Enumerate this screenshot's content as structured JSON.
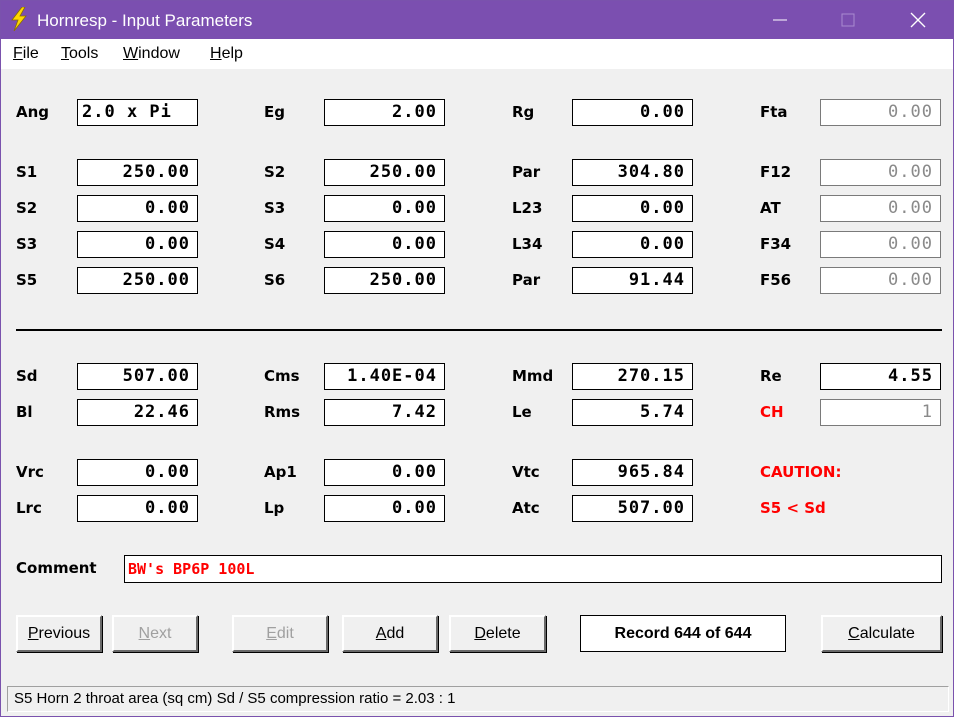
{
  "window": {
    "title": "Hornresp - Input Parameters",
    "icon": "lightning-bolt-icon"
  },
  "menu": {
    "file": {
      "key": "F",
      "rest": "ile"
    },
    "tools": {
      "key": "T",
      "rest": "ools"
    },
    "window": {
      "key": "W",
      "rest": "indow"
    },
    "help": {
      "key": "H",
      "rest": "elp"
    }
  },
  "params": {
    "ang": {
      "label": "Ang",
      "value": "2.0 x Pi"
    },
    "eg": {
      "label": "Eg",
      "value": "2.00"
    },
    "rg": {
      "label": "Rg",
      "value": "0.00"
    },
    "fta": {
      "label": "Fta",
      "value": "0.00"
    },
    "s1": {
      "label": "S1",
      "value": "250.00"
    },
    "s2b": {
      "label": "S2",
      "value": "250.00"
    },
    "par1": {
      "label": "Par",
      "value": "304.80"
    },
    "f12": {
      "label": "F12",
      "value": "0.00"
    },
    "s2": {
      "label": "S2",
      "value": "0.00"
    },
    "s3b": {
      "label": "S3",
      "value": "0.00"
    },
    "l23": {
      "label": "L23",
      "value": "0.00"
    },
    "at": {
      "label": "AT",
      "value": "0.00"
    },
    "s3": {
      "label": "S3",
      "value": "0.00"
    },
    "s4": {
      "label": "S4",
      "value": "0.00"
    },
    "l34": {
      "label": "L34",
      "value": "0.00"
    },
    "f34": {
      "label": "F34",
      "value": "0.00"
    },
    "s5": {
      "label": "S5",
      "value": "250.00"
    },
    "s6": {
      "label": "S6",
      "value": "250.00"
    },
    "par2": {
      "label": "Par",
      "value": "91.44"
    },
    "f56": {
      "label": "F56",
      "value": "0.00"
    },
    "sd": {
      "label": "Sd",
      "value": "507.00"
    },
    "cms": {
      "label": "Cms",
      "value": "1.40E-04"
    },
    "mmd": {
      "label": "Mmd",
      "value": "270.15"
    },
    "re": {
      "label": "Re",
      "value": "4.55"
    },
    "bl": {
      "label": "Bl",
      "value": "22.46"
    },
    "rms": {
      "label": "Rms",
      "value": "7.42"
    },
    "le": {
      "label": "Le",
      "value": "5.74"
    },
    "ch": {
      "label": "CH",
      "value": "1"
    },
    "vrc": {
      "label": "Vrc",
      "value": "0.00"
    },
    "ap1": {
      "label": "Ap1",
      "value": "0.00"
    },
    "vtc": {
      "label": "Vtc",
      "value": "965.84"
    },
    "lrc": {
      "label": "Lrc",
      "value": "0.00"
    },
    "lp": {
      "label": "Lp",
      "value": "0.00"
    },
    "atc": {
      "label": "Atc",
      "value": "507.00"
    }
  },
  "caution": {
    "title": "CAUTION:",
    "message": "S5 < Sd"
  },
  "comment": {
    "label": "Comment",
    "value": "BW's BP6P 100L"
  },
  "buttons": {
    "previous": {
      "key": "P",
      "rest": "revious"
    },
    "next": {
      "key": "N",
      "rest": "ext"
    },
    "edit": {
      "key": "E",
      "rest": "dit"
    },
    "add": {
      "key": "A",
      "rest": "dd"
    },
    "delete": {
      "key": "D",
      "rest": "elete"
    },
    "calculate": {
      "key": "C",
      "rest": "alculate"
    }
  },
  "record": "Record 644 of 644",
  "status": "S5   Horn 2 throat area  (sq cm)   Sd / S5 compression ratio = 2.03 : 1",
  "colors": {
    "titlebar": "#7b4fb0",
    "warning": "#ff0000",
    "icon_bolt": "#ffd700"
  }
}
